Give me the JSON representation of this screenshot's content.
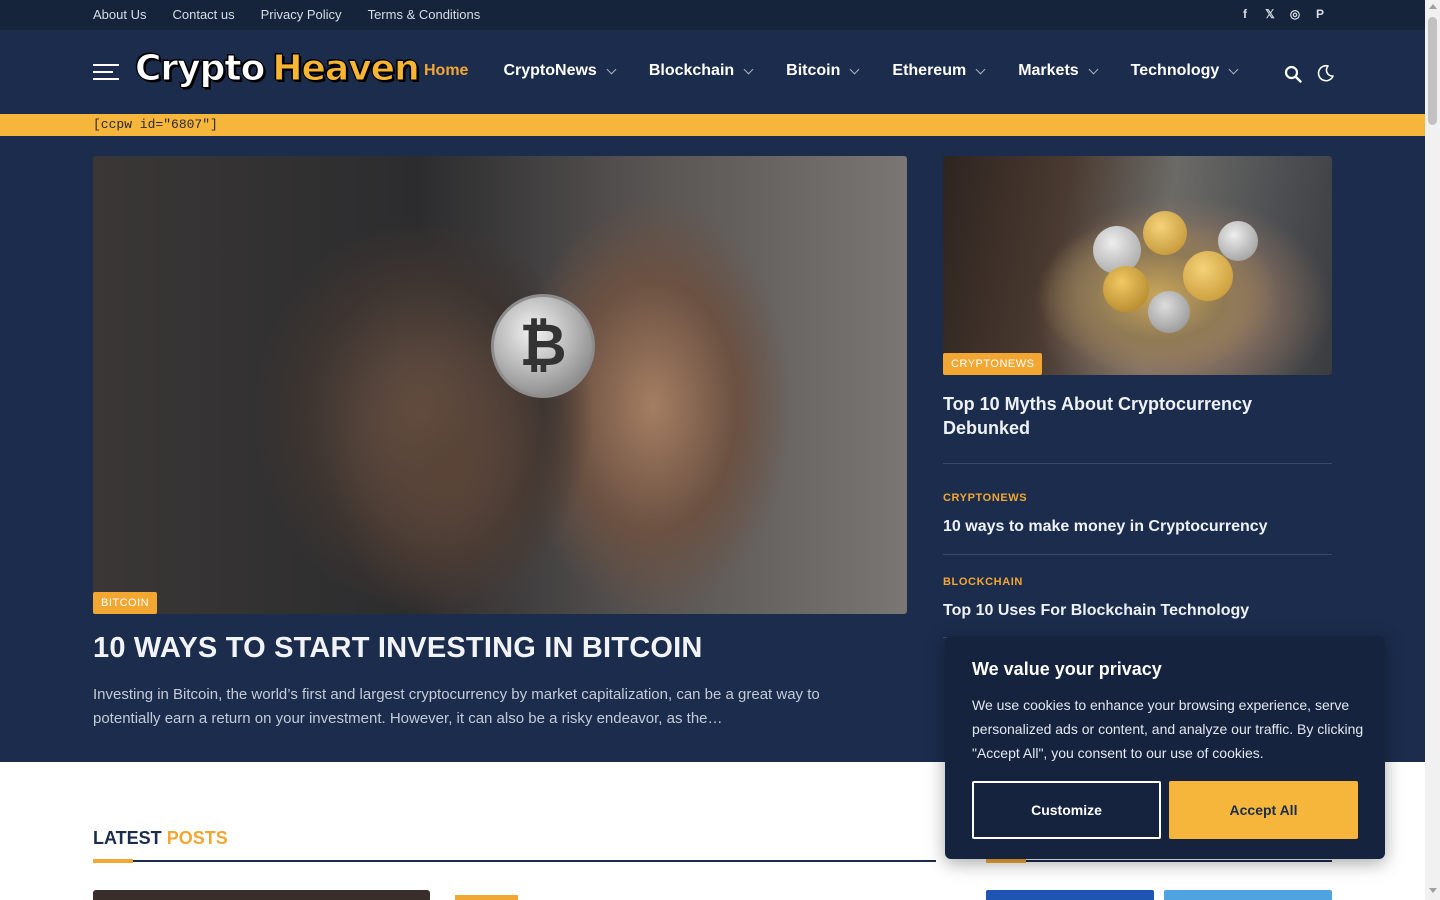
{
  "topbar": {
    "links": [
      "About Us",
      "Contact us",
      "Privacy Policy",
      "Terms & Conditions"
    ],
    "social": [
      {
        "icon": "facebook-icon",
        "glyph": "f"
      },
      {
        "icon": "x-icon",
        "glyph": "𝕏"
      },
      {
        "icon": "instagram-icon",
        "glyph": "◎"
      },
      {
        "icon": "pinterest-icon",
        "glyph": "P"
      }
    ]
  },
  "header": {
    "logo_part1": "Crypto",
    "logo_part2": "Heaven",
    "nav": [
      {
        "label": "Home",
        "active": true,
        "dropdown": false
      },
      {
        "label": "CryptoNews",
        "active": false,
        "dropdown": true
      },
      {
        "label": "Blockchain",
        "active": false,
        "dropdown": true
      },
      {
        "label": "Bitcoin",
        "active": false,
        "dropdown": true
      },
      {
        "label": "Ethereum",
        "active": false,
        "dropdown": true
      },
      {
        "label": "Markets",
        "active": false,
        "dropdown": true
      },
      {
        "label": "Technology",
        "active": false,
        "dropdown": true
      }
    ]
  },
  "ticker": {
    "text": "[ccpw id=\"6807\"]"
  },
  "hero": {
    "category": "BITCOIN",
    "title": "10 WAYS TO START INVESTING IN BITCOIN",
    "excerpt": "Investing in Bitcoin, the world’s first and largest cryptocurrency by market capitalization, can be a great way to potentially earn a return on your investment. However, it can also be a risky endeavor, as the…"
  },
  "side": {
    "featured": {
      "category": "CRYPTONEWS",
      "title": "Top 10 Myths About Cryptocurrency Debunked"
    },
    "posts": [
      {
        "category": "CRYPTONEWS",
        "title": "10 ways to make money in Cryptocurrency"
      },
      {
        "category": "BLOCKCHAIN",
        "title": "Top 10 Uses For Blockchain Technology"
      }
    ]
  },
  "latest": {
    "title_part1": "LATEST",
    "title_part2": "POSTS"
  },
  "cookie": {
    "title": "We value your privacy",
    "text": "We use cookies to enhance your browsing experience, serve personalized ads or content, and analyze our traffic. By clicking \"Accept All\", you consent to our use of cookies.",
    "customize_label": "Customize",
    "accept_label": "Accept All"
  },
  "colors": {
    "accent": "#f3a733",
    "navy": "#1b2c4c",
    "dark_navy": "#15233b"
  }
}
